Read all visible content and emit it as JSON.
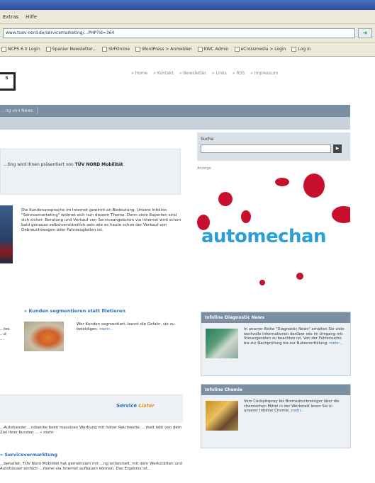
{
  "browser": {
    "title": "",
    "menu": [
      "Extras",
      "Hilfe"
    ],
    "address": "www.tuev-nord.de/servicemarketing/...PHP?id=364",
    "bookmarks": [
      "NCPS 6.0 Login",
      "Spanier Newsletter...",
      "SIIFOnline",
      "WordPress > Anmelden",
      "KWC Admin",
      "eCrossmedia > Login",
      "Log in"
    ]
  },
  "site": {
    "logo_text": "S",
    "topnav": [
      "» Home",
      "» Kontakt",
      "» Newsletter",
      "» Links",
      "» RSS",
      "» Impressum"
    ],
    "mainnav": [
      "...ng von News"
    ],
    "intro": {
      "text": "...ting wird Ihnen präsentiert von",
      "brand": "TÜV NORD Mobilität"
    },
    "article1": "Die Kundenansprache im Internet gewinnt an Bedeutung. Unsere Infoline \"Servicemarketing\" widmet sich nun diesem Thema. Denn viele Experten sind sich sicher: Beratung und Verkauf von Serviceangeboten via Internet wird schon bald genauso selbstverständlich sein wie es heute schon der Verkauf von Gebrauchtwagen oder Fahrzeugteilen ist.",
    "headline2": "» Kunden segmentieren statt filetieren",
    "article2_left": "...tes\n...d\n...",
    "article2": "Wer Kunden segmentiert, bannt die Gefahr, sie zu beleidigen.",
    "more": "mehr...",
    "service_label": "Service",
    "service_lister": "Lister",
    "service_text": "...Autohandel ...ndsenke beim massiven Werbung mit hoher Reichweite. ...rkeit lebt von dem Ziel Ihrer Kunden ... » mehr",
    "headline3": "» Servicevermarktung",
    "article3": "...behaltet: TÜV Nord Mobilität hat gemeinsam mit ...ng entwickelt, mit dem Werkstätten und Autohäuser einfach ...rberei via Internet aufbauen können. Das Ergebnis ist..."
  },
  "sidebar": {
    "search_label": "Suche",
    "search_button": "▶",
    "ad_label": "Anzeige",
    "ad_text_a": "automechan",
    "box1": {
      "title": "Infoline Diagnostic News",
      "text": "In unserer Reihe \"Diagnostic News\" erhalten Sie viele wertvolle Informationen darüber wie im Umgang mit Steuergeräten zu beachten ist. Von der Fehlersuche bis zur Nachprüfung bis zur Nutzenerfüllung.",
      "more": "mehr..."
    },
    "box2": {
      "title": "Infoline Chemie",
      "text": "Vom Cockpitspray bis Bremsdruckreiniger über die chemischen Mittel in der Werkstatt lesen Sie in unserer Infoline Chemie.",
      "more": "mehr..."
    }
  }
}
